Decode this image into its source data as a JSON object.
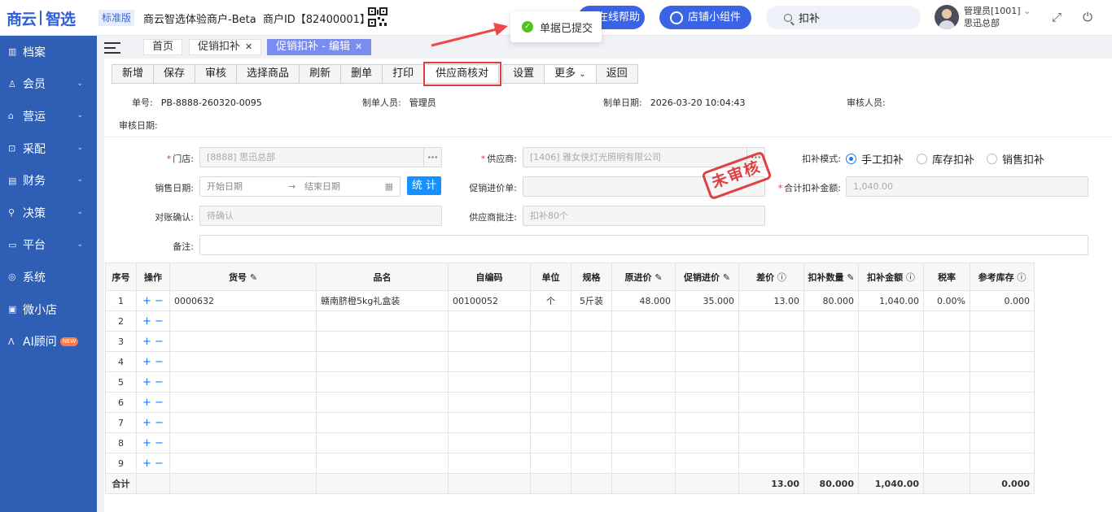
{
  "header": {
    "logo_left": "商云",
    "logo_right": "智选",
    "edition": "标准版",
    "merchant": "商云智选体验商户-Beta",
    "merchant_id": "商户ID【82400001】",
    "help_button": "在线帮助",
    "widget_button": "店铺小组件",
    "search_value": "扣补",
    "user_name": "管理员[1001]",
    "user_org": "思迅总部"
  },
  "toast": {
    "message": "单据已提交"
  },
  "sidebar": {
    "items": [
      {
        "label": "档案",
        "icon": "archive-icon",
        "expandable": false
      },
      {
        "label": "会员",
        "icon": "user-icon",
        "expandable": true
      },
      {
        "label": "营运",
        "icon": "shop-icon",
        "expandable": true
      },
      {
        "label": "采配",
        "icon": "purchase-icon",
        "expandable": true
      },
      {
        "label": "财务",
        "icon": "finance-icon",
        "expandable": true
      },
      {
        "label": "决策",
        "icon": "decision-icon",
        "expandable": true
      },
      {
        "label": "平台",
        "icon": "platform-icon",
        "expandable": true
      },
      {
        "label": "系统",
        "icon": "system-icon",
        "expandable": false
      },
      {
        "label": "微小店",
        "icon": "mini-store-icon",
        "expandable": false
      },
      {
        "label": "AI顾问",
        "icon": "ai-icon",
        "expandable": false,
        "badge": "NEW"
      }
    ]
  },
  "tabs": [
    {
      "label": "首页",
      "closable": false,
      "active": false
    },
    {
      "label": "促销扣补",
      "closable": true,
      "active": false
    },
    {
      "label": "促销扣补 - 编辑",
      "closable": true,
      "active": true
    }
  ],
  "toolbar": {
    "buttons": [
      "新增",
      "保存",
      "审核",
      "选择商品",
      "刷新",
      "删单",
      "打印",
      "供应商核对",
      "设置",
      "更多",
      "返回"
    ]
  },
  "meta": {
    "doc_no_label": "单号:",
    "doc_no": "PB-8888-260320-0095",
    "maker_label": "制单人员:",
    "maker": "管理员",
    "make_date_label": "制单日期:",
    "make_date": "2026-03-20 10:04:43",
    "auditor_label": "审核人员:",
    "audit_date_label": "审核日期:"
  },
  "form": {
    "store_label": "门店:",
    "store_value": "[8888]   思迅总部",
    "supplier_label": "供应商:",
    "supplier_value": "[1406]   雅女侠灯光照明有限公司",
    "mode_label": "扣补模式:",
    "mode_options": [
      "手工扣补",
      "库存扣补",
      "销售扣补"
    ],
    "mode_selected": "手工扣补",
    "sale_date_label": "销售日期:",
    "start_date_placeholder": "开始日期",
    "end_date_placeholder": "结束日期",
    "stat_button": "统 计",
    "promo_price_label": "促销进价单:",
    "total_amount_label": "合计扣补金额:",
    "total_amount_value": "1,040.00",
    "reconcile_label": "对账确认:",
    "reconcile_value": "待确认",
    "supplier_note_label": "供应商批注:",
    "supplier_note_value": "扣补80个",
    "remark_label": "备注:",
    "stamp": "未审核"
  },
  "table": {
    "columns": [
      "序号",
      "操作",
      "货号",
      "品名",
      "自编码",
      "单位",
      "规格",
      "原进价",
      "促销进价",
      "差价",
      "扣补数量",
      "扣补金额",
      "税率",
      "参考库存"
    ],
    "rows": [
      [
        "1",
        "+ −",
        "0000632",
        "赣南脐橙5kg礼盒装",
        "00100052",
        "个",
        "5斤装",
        "48.000",
        "35.000",
        "13.00",
        "80.000",
        "1,040.00",
        "0.00%",
        "0.000"
      ],
      [
        "2",
        "+ −",
        "",
        "",
        "",
        "",
        "",
        "",
        "",
        "",
        "",
        "",
        "",
        ""
      ],
      [
        "3",
        "+ −",
        "",
        "",
        "",
        "",
        "",
        "",
        "",
        "",
        "",
        "",
        "",
        ""
      ],
      [
        "4",
        "+ −",
        "",
        "",
        "",
        "",
        "",
        "",
        "",
        "",
        "",
        "",
        "",
        ""
      ],
      [
        "5",
        "+ −",
        "",
        "",
        "",
        "",
        "",
        "",
        "",
        "",
        "",
        "",
        "",
        ""
      ],
      [
        "6",
        "+ −",
        "",
        "",
        "",
        "",
        "",
        "",
        "",
        "",
        "",
        "",
        "",
        ""
      ],
      [
        "7",
        "+ −",
        "",
        "",
        "",
        "",
        "",
        "",
        "",
        "",
        "",
        "",
        "",
        ""
      ],
      [
        "8",
        "+ −",
        "",
        "",
        "",
        "",
        "",
        "",
        "",
        "",
        "",
        "",
        "",
        ""
      ],
      [
        "9",
        "+ −",
        "",
        "",
        "",
        "",
        "",
        "",
        "",
        "",
        "",
        "",
        "",
        ""
      ]
    ],
    "totals": [
      "合计",
      "",
      "",
      "",
      "",
      "",
      "",
      "",
      "",
      "13.00",
      "80.000",
      "1,040.00",
      "",
      "0.000"
    ]
  }
}
